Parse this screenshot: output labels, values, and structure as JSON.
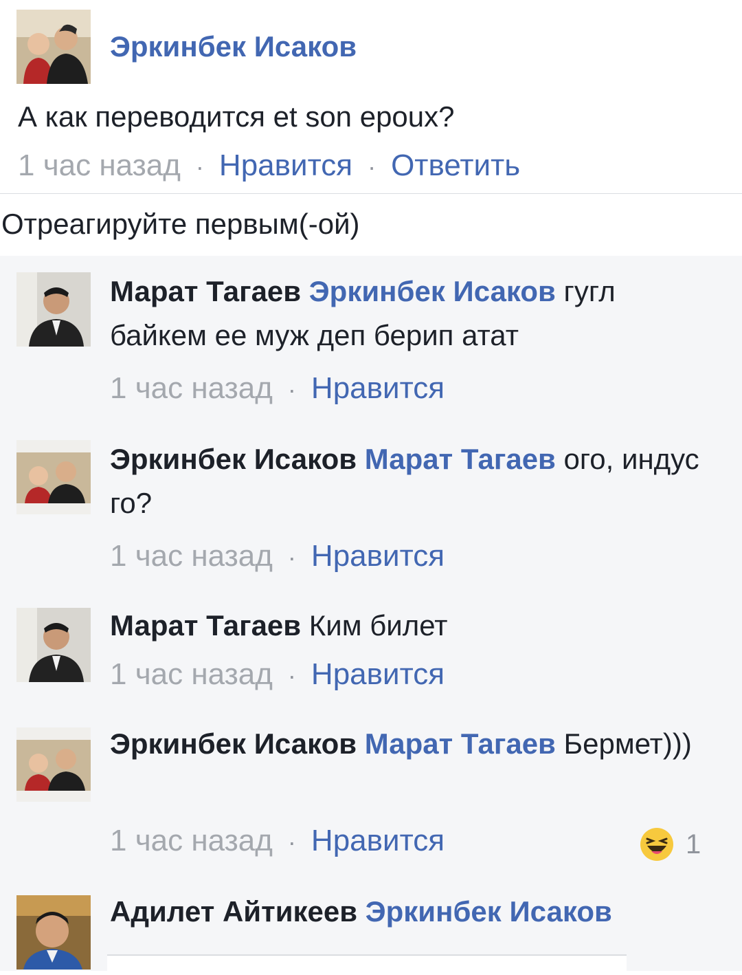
{
  "post": {
    "author": "Эркинбек Исаков",
    "text": "А как переводится et son epoux?",
    "time": "1 час назад",
    "like_label": "Нравится",
    "reply_label": "Ответить",
    "separator": "·"
  },
  "reactions_prompt": "Отреагируйте первым(-ой)",
  "replies": [
    {
      "author": "Марат Тагаев",
      "mention": "Эркинбек Исаков",
      "text": " гугл байкем ее муж деп берип атат",
      "time": "1 час назад",
      "like_label": "Нравится"
    },
    {
      "author": "Эркинбек Исаков",
      "mention": "Марат Тагаев",
      "text": " ого, индус го?",
      "time": "1 час назад",
      "like_label": "Нравится"
    },
    {
      "author": "Марат Тагаев",
      "text": " Ким билет",
      "time": "1 час назад",
      "like_label": "Нравится"
    },
    {
      "author": "Эркинбек Исаков",
      "mention": "Марат Тагаев",
      "text": " Бермет)))",
      "time": "1 час назад",
      "like_label": "Нравится",
      "reaction": {
        "icon": "haha-emoji-icon",
        "count": "1"
      }
    },
    {
      "author": "Адилет Айтикеев",
      "mention": "Эркинбек Исаков"
    }
  ],
  "colors": {
    "link": "#4267b2",
    "text": "#1d2129",
    "muted": "#90949c",
    "reply_bg": "#f5f6f8"
  }
}
